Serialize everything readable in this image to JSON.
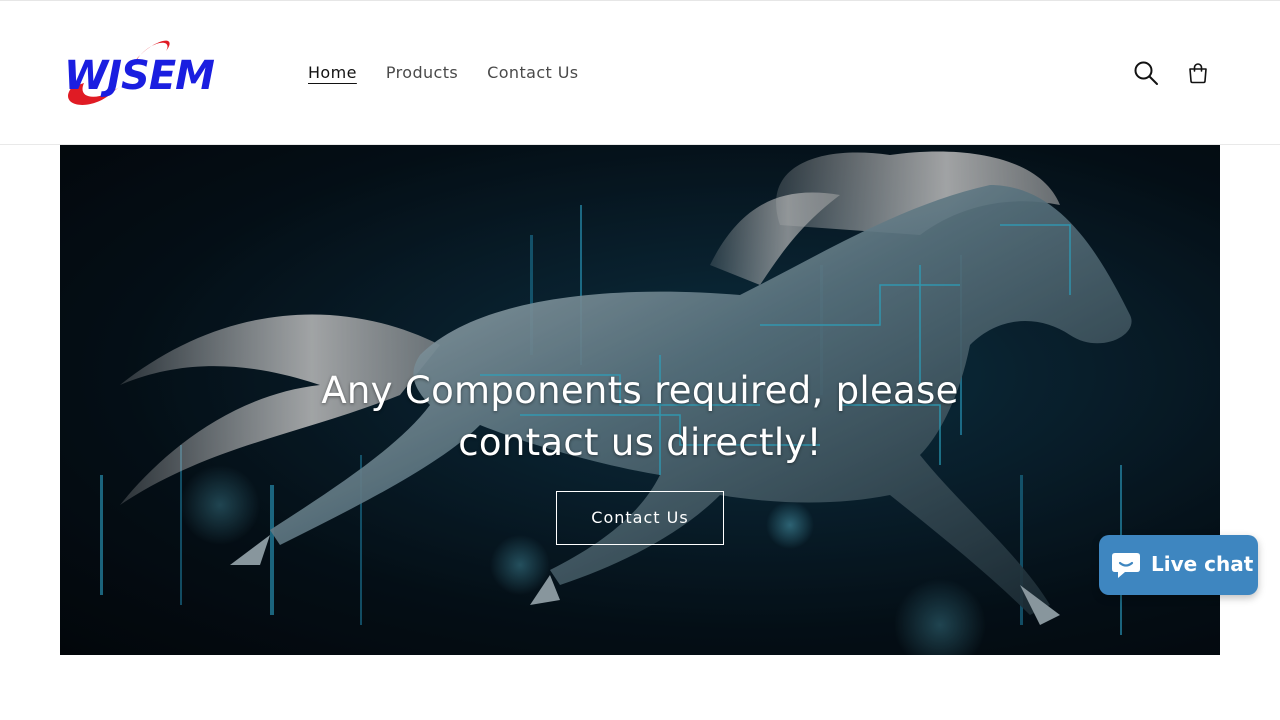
{
  "header": {
    "logo_text": "WJSEM",
    "nav": [
      {
        "label": "Home",
        "active": true
      },
      {
        "label": "Products",
        "active": false
      },
      {
        "label": "Contact Us",
        "active": false
      }
    ],
    "icons": [
      "search-icon",
      "cart-icon"
    ]
  },
  "hero": {
    "heading": "Any Components required, please contact us directly!",
    "button_label": "Contact Us"
  },
  "live_chat": {
    "label": "Live chat",
    "icon": "chat-bubble-icon"
  },
  "colors": {
    "logo_blue": "#1a1ee0",
    "logo_red": "#e01b24",
    "chat_blue": "#3e86c0",
    "hero_cyan": "#34c6e8"
  }
}
